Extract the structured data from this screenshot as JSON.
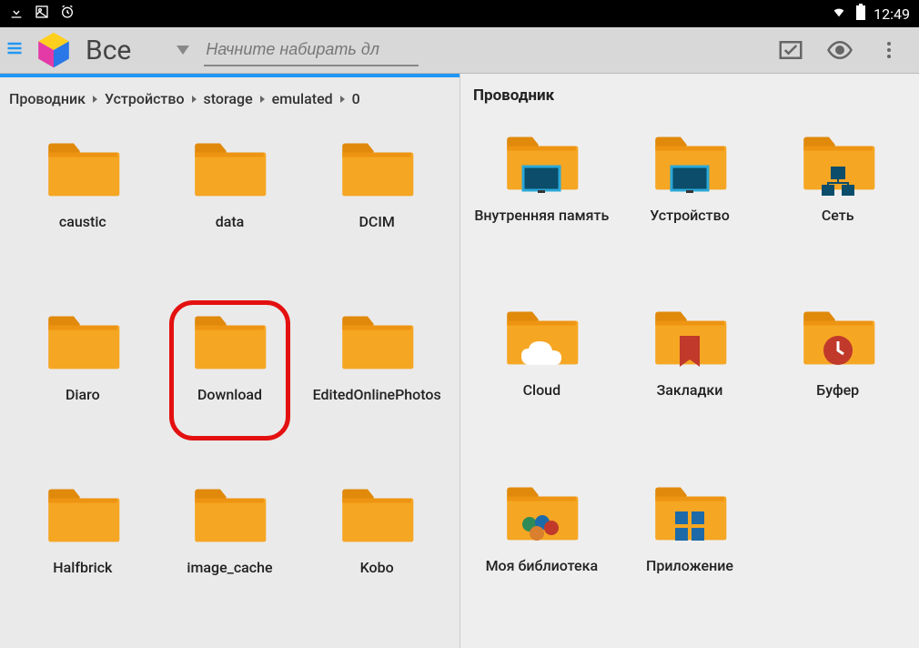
{
  "status": {
    "time": "12:49"
  },
  "toolbar": {
    "filter_label": "Все",
    "search_placeholder": "Начните набирать дл"
  },
  "left": {
    "breadcrumb": [
      "Проводник",
      "Устройство",
      "storage",
      "emulated",
      "0"
    ],
    "items": [
      {
        "label": "caustic",
        "type": "folder",
        "highlighted": false
      },
      {
        "label": "data",
        "type": "folder",
        "highlighted": false
      },
      {
        "label": "DCIM",
        "type": "folder",
        "highlighted": false
      },
      {
        "label": "Diaro",
        "type": "folder",
        "highlighted": false
      },
      {
        "label": "Download",
        "type": "folder",
        "highlighted": true
      },
      {
        "label": "EditedOnlinePhotos",
        "type": "folder",
        "highlighted": false
      },
      {
        "label": "Halfbrick",
        "type": "folder",
        "highlighted": false
      },
      {
        "label": "image_cache",
        "type": "folder",
        "highlighted": false
      },
      {
        "label": "Kobo",
        "type": "folder",
        "highlighted": false
      }
    ]
  },
  "right": {
    "title": "Проводник",
    "items": [
      {
        "label": "Внутренняя память",
        "type": "internal"
      },
      {
        "label": "Устройство",
        "type": "device"
      },
      {
        "label": "Сеть",
        "type": "network"
      },
      {
        "label": "Cloud",
        "type": "cloud"
      },
      {
        "label": "Закладки",
        "type": "bookmark"
      },
      {
        "label": "Буфер",
        "type": "buffer"
      },
      {
        "label": "Моя библиотека",
        "type": "library"
      },
      {
        "label": "Приложение",
        "type": "apps"
      }
    ]
  }
}
